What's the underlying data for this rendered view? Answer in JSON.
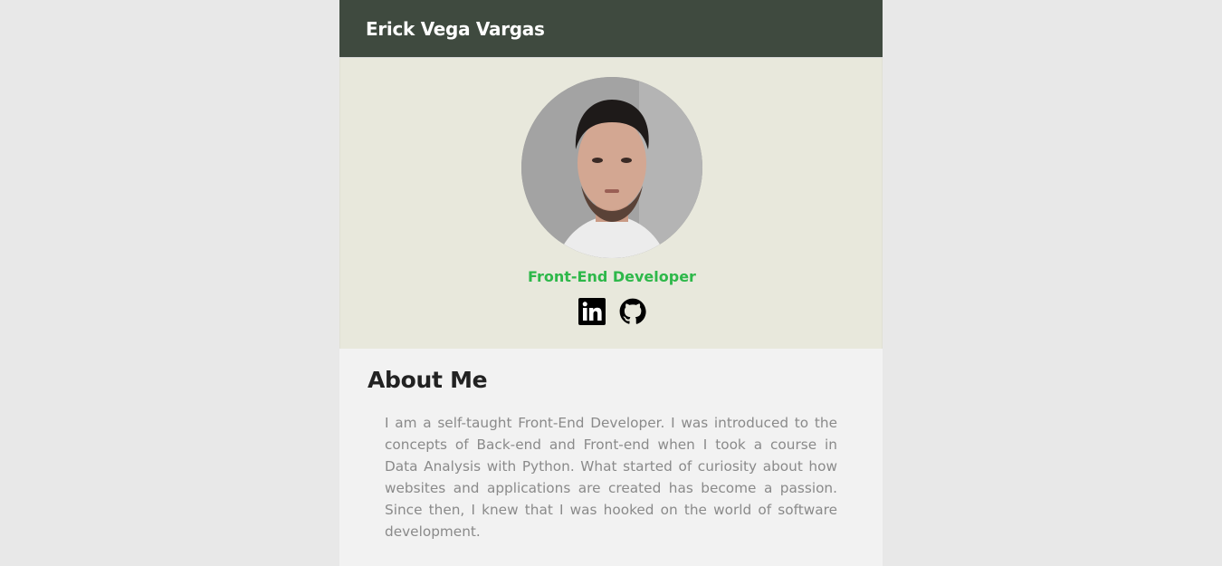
{
  "header": {
    "title": "Erick Vega Vargas"
  },
  "profile": {
    "role": "Front-End Developer",
    "photo": "portrait-photo",
    "socials": [
      {
        "name": "linkedin-icon"
      },
      {
        "name": "github-icon"
      }
    ]
  },
  "about": {
    "heading": "About Me",
    "text": "I am a self-taught Front-End Developer. I was introduced to the concepts of Back-end and Front-end when I took a course in Data Analysis with Python. What started of curiosity about how websites and applications are created has become a passion. Since then, I knew that I was hooked on the world of software development."
  },
  "colors": {
    "page_background": "#e8e8e8",
    "header_background": "#3f4a3f",
    "hero_background": "#e8e8dc",
    "role_accent": "#2eb84a",
    "content_background": "#f2f2f2",
    "body_text": "#8a8a8a"
  }
}
